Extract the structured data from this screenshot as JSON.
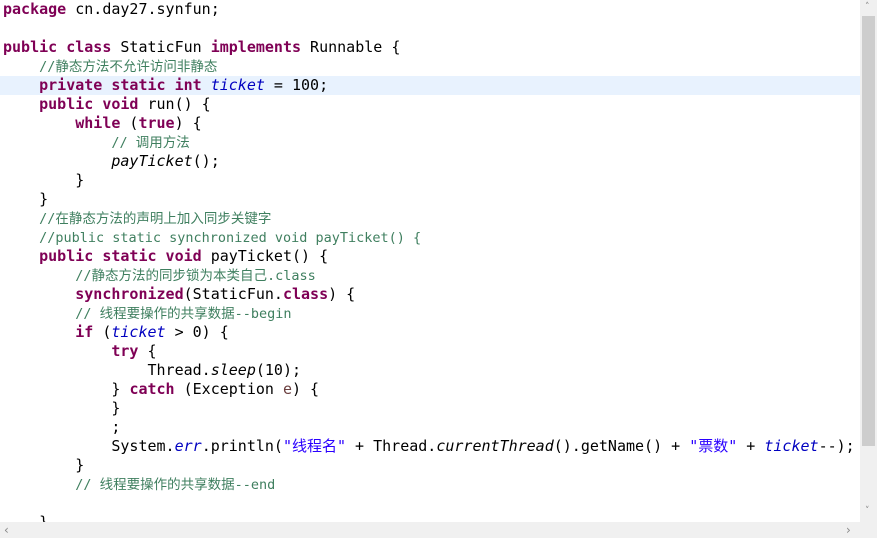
{
  "editor": {
    "highlighted_line": 5,
    "colors": {
      "keyword": "#7f0055",
      "comment": "#3f7f5f",
      "field": "#0000c0",
      "string": "#2a00ff",
      "current_line": "#e8f2fe"
    },
    "lines": [
      [
        {
          "t": "package",
          "k": "kw"
        },
        {
          "t": " cn.day27.synfun;",
          "k": "pl"
        }
      ],
      [],
      [
        {
          "t": "public class",
          "k": "kw"
        },
        {
          "t": " StaticFun ",
          "k": "pl"
        },
        {
          "t": "implements",
          "k": "kw"
        },
        {
          "t": " Runnable {",
          "k": "pl"
        }
      ],
      [
        {
          "t": "    ",
          "k": "pl"
        },
        {
          "t": "//静态方法不允许访问非静态",
          "k": "cm"
        }
      ],
      [
        {
          "t": "    ",
          "k": "pl"
        },
        {
          "t": "private static int",
          "k": "kw"
        },
        {
          "t": " ",
          "k": "pl"
        },
        {
          "t": "ticket",
          "k": "fd"
        },
        {
          "t": " = 100;",
          "k": "pl"
        }
      ],
      [
        {
          "t": "    ",
          "k": "pl"
        },
        {
          "t": "public void",
          "k": "kw"
        },
        {
          "t": " run() {",
          "k": "pl"
        }
      ],
      [
        {
          "t": "        ",
          "k": "pl"
        },
        {
          "t": "while",
          "k": "kw"
        },
        {
          "t": " (",
          "k": "pl"
        },
        {
          "t": "true",
          "k": "kw"
        },
        {
          "t": ") {",
          "k": "pl"
        }
      ],
      [
        {
          "t": "            ",
          "k": "pl"
        },
        {
          "t": "// 调用方法",
          "k": "cm"
        }
      ],
      [
        {
          "t": "            ",
          "k": "pl"
        },
        {
          "t": "payTicket",
          "k": "sm"
        },
        {
          "t": "();",
          "k": "pl"
        }
      ],
      [
        {
          "t": "        }",
          "k": "pl"
        }
      ],
      [
        {
          "t": "    }",
          "k": "pl"
        }
      ],
      [
        {
          "t": "    ",
          "k": "pl"
        },
        {
          "t": "//在静态方法的声明上加入同步关键字",
          "k": "cm"
        }
      ],
      [
        {
          "t": "    ",
          "k": "pl"
        },
        {
          "t": "//public static synchronized void payTicket() {",
          "k": "cm"
        }
      ],
      [
        {
          "t": "    ",
          "k": "pl"
        },
        {
          "t": "public static void",
          "k": "kw"
        },
        {
          "t": " payTicket() {",
          "k": "pl"
        }
      ],
      [
        {
          "t": "        ",
          "k": "pl"
        },
        {
          "t": "//静态方法的同步锁为本类自己.class",
          "k": "cm"
        }
      ],
      [
        {
          "t": "        ",
          "k": "pl"
        },
        {
          "t": "synchronized",
          "k": "kw"
        },
        {
          "t": "(StaticFun.",
          "k": "pl"
        },
        {
          "t": "class",
          "k": "kw"
        },
        {
          "t": ") {",
          "k": "pl"
        }
      ],
      [
        {
          "t": "        ",
          "k": "pl"
        },
        {
          "t": "// 线程要操作的共享数据--begin",
          "k": "cm"
        }
      ],
      [
        {
          "t": "        ",
          "k": "pl"
        },
        {
          "t": "if",
          "k": "kw"
        },
        {
          "t": " (",
          "k": "pl"
        },
        {
          "t": "ticket",
          "k": "fd"
        },
        {
          "t": " > 0) {",
          "k": "pl"
        }
      ],
      [
        {
          "t": "            ",
          "k": "pl"
        },
        {
          "t": "try",
          "k": "kw"
        },
        {
          "t": " {",
          "k": "pl"
        }
      ],
      [
        {
          "t": "                Thread.",
          "k": "pl"
        },
        {
          "t": "sleep",
          "k": "sm"
        },
        {
          "t": "(10);",
          "k": "pl"
        }
      ],
      [
        {
          "t": "            } ",
          "k": "pl"
        },
        {
          "t": "catch",
          "k": "kw"
        },
        {
          "t": " (Exception ",
          "k": "pl"
        },
        {
          "t": "e",
          "k": "pv"
        },
        {
          "t": ") {",
          "k": "pl"
        }
      ],
      [
        {
          "t": "            }",
          "k": "pl"
        }
      ],
      [
        {
          "t": "            ;",
          "k": "pl"
        }
      ],
      [
        {
          "t": "            System.",
          "k": "pl"
        },
        {
          "t": "err",
          "k": "fd"
        },
        {
          "t": ".println(",
          "k": "pl"
        },
        {
          "t": "\"线程名\"",
          "k": "st"
        },
        {
          "t": " + Thread.",
          "k": "pl"
        },
        {
          "t": "currentThread",
          "k": "sm"
        },
        {
          "t": "().getName() + ",
          "k": "pl"
        },
        {
          "t": "\"票数\"",
          "k": "st"
        },
        {
          "t": " + ",
          "k": "pl"
        },
        {
          "t": "ticket",
          "k": "fd"
        },
        {
          "t": "--);",
          "k": "pl"
        }
      ],
      [
        {
          "t": "        }",
          "k": "pl"
        }
      ],
      [
        {
          "t": "        ",
          "k": "pl"
        },
        {
          "t": "// 线程要操作的共享数据--end",
          "k": "cm"
        }
      ],
      [],
      [
        {
          "t": "    }",
          "k": "pl"
        }
      ]
    ]
  },
  "scrollbars": {
    "vertical_position": 0,
    "up_arrow": "˄",
    "down_arrow": "˅",
    "left_arrow": "‹",
    "right_arrow": "›"
  }
}
